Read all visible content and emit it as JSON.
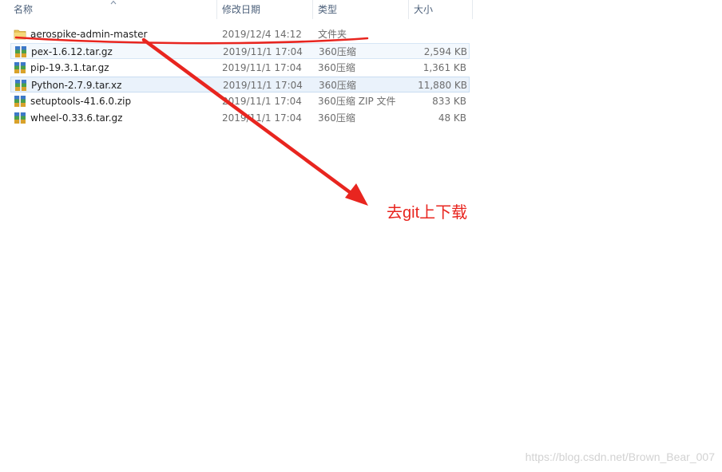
{
  "columns": {
    "name": "名称",
    "date": "修改日期",
    "type": "类型",
    "size": "大小"
  },
  "files": [
    {
      "name": "aerospike-admin-master",
      "date": "2019/12/4 14:12",
      "type": "文件夹",
      "size": "",
      "icon": "folder-icon"
    },
    {
      "name": "pex-1.6.12.tar.gz",
      "date": "2019/11/1 17:04",
      "type": "360压缩",
      "size": "2,594 KB",
      "icon": "archive-icon"
    },
    {
      "name": "pip-19.3.1.tar.gz",
      "date": "2019/11/1 17:04",
      "type": "360压缩",
      "size": "1,361 KB",
      "icon": "archive-icon"
    },
    {
      "name": "Python-2.7.9.tar.xz",
      "date": "2019/11/1 17:04",
      "type": "360压缩",
      "size": "11,880 KB",
      "icon": "archive-icon"
    },
    {
      "name": "setuptools-41.6.0.zip",
      "date": "2019/11/1 17:04",
      "type": "360压缩 ZIP 文件",
      "size": "833 KB",
      "icon": "archive-icon"
    },
    {
      "name": "wheel-0.33.6.tar.gz",
      "date": "2019/11/1 17:04",
      "type": "360压缩",
      "size": "48 KB",
      "icon": "archive-icon"
    }
  ],
  "annotation": "去git上下载",
  "watermark": "https://blog.csdn.net/Brown_Bear_007",
  "colors": {
    "annotation": "#e8251f",
    "header_text": "#4c607a",
    "selection": "#eaf2fb"
  }
}
